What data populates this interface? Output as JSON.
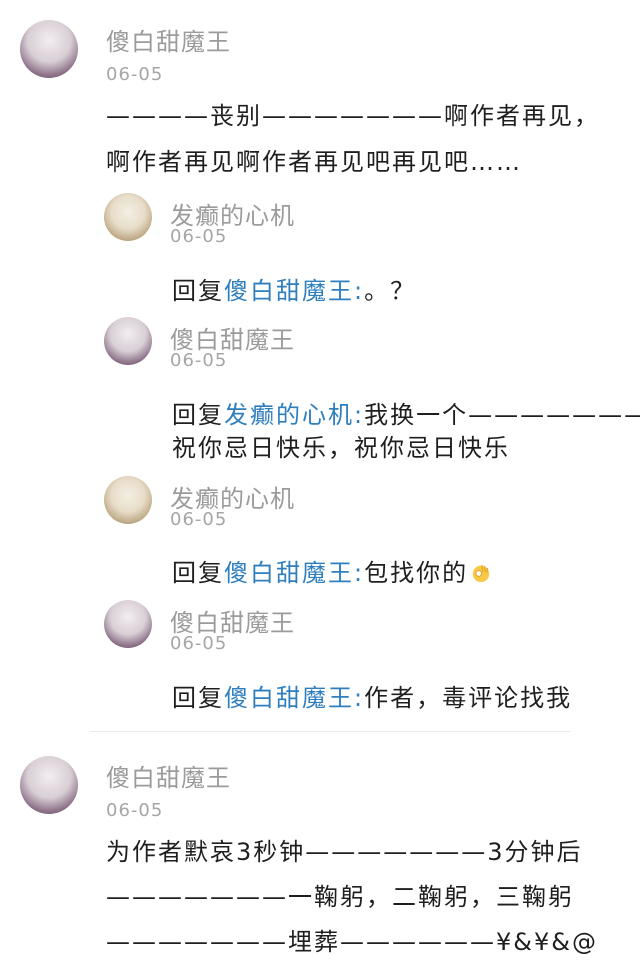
{
  "comments": [
    {
      "user": "傻白甜魔王",
      "date": "06-05",
      "text_lines": [
        "————丧别———————啊作者再见，",
        "啊作者再见啊作者再见吧再见吧……"
      ],
      "replies": [
        {
          "user": "发癫的心机",
          "date": "06-05",
          "prefix": "回复",
          "mention": "傻白甜魔王:",
          "text_lines": [
            "。？"
          ]
        },
        {
          "user": "傻白甜魔王",
          "date": "06-05",
          "prefix": "回复",
          "mention": "发癫的心机:",
          "text_lines": [
            "我换一个———————",
            "祝你忌日快乐，祝你忌日快乐"
          ]
        },
        {
          "user": "发癫的心机",
          "date": "06-05",
          "prefix": "回复",
          "mention": "傻白甜魔王:",
          "text_lines": [
            "包找你的"
          ],
          "emoji": "ok-hand-emoji"
        },
        {
          "user": "傻白甜魔王",
          "date": "06-05",
          "prefix": "回复",
          "mention": "傻白甜魔王:",
          "text_lines": [
            "作者，毒评论找我"
          ]
        }
      ]
    },
    {
      "user": "傻白甜魔王",
      "date": "06-05",
      "text_lines": [
        "为作者默哀3秒钟———————3分钟后",
        "———————一鞠躬，二鞠躬，三鞠躬",
        "———————埋葬——————¥&¥&@"
      ]
    }
  ],
  "colors": {
    "mention": "#2f7fbf",
    "name": "#9b9b9b",
    "text": "#1f1f1f"
  }
}
